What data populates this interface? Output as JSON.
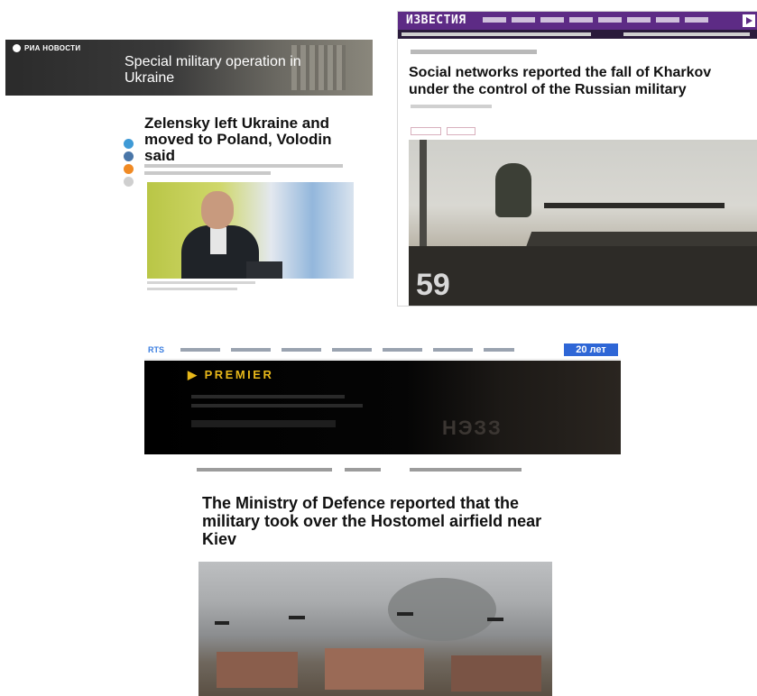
{
  "ria": {
    "logo": "РИА НОВОСТИ",
    "banner_title": "Special military operation in Ukraine",
    "headline": "Zelensky left Ukraine and moved to Poland, Volodin said"
  },
  "izvestia": {
    "logo": "ИЗВЕСТИЯ",
    "headline": "Social networks reported the fall of Kharkov under the control of the Russian military",
    "photo_number": "59"
  },
  "rts": {
    "logo": "RTS",
    "badge": "20 лет",
    "ad_label": "▶ PREMIER",
    "ad_ghost": "НЭЗЗ",
    "headline": "The Ministry of Defence reported that the military took over the Hostomel airfield near Kiev"
  },
  "colors": {
    "izvestia_nav": "#5d2b85",
    "premier_gold": "#e8b81a",
    "rts_blue": "#2e66d6"
  },
  "icons": [
    "share-twitter-icon",
    "share-vk-icon",
    "share-ok-icon",
    "share-more-icon",
    "play-icon"
  ]
}
